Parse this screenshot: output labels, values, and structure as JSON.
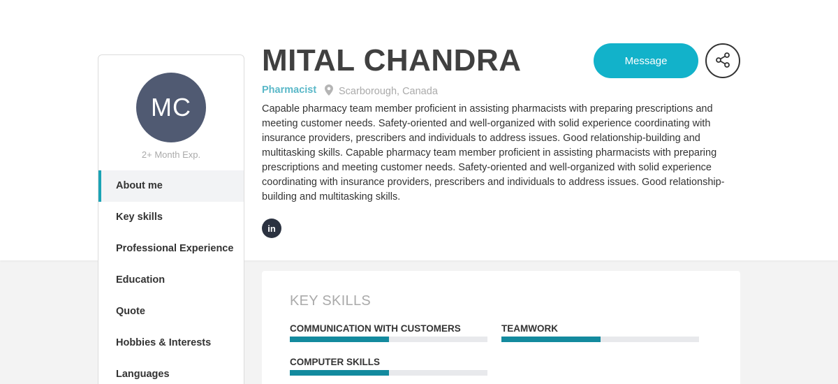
{
  "profile": {
    "initials": "MC",
    "experience": "2+ Month Exp.",
    "name": "MITAL CHANDRA",
    "role": "Pharmacist",
    "location": "Scarborough, Canada",
    "bio": "Capable pharmacy team member proficient in assisting pharmacists with preparing prescriptions and meeting customer needs. Safety-oriented and well-organized with solid experience coordinating with insurance providers, prescribers and individuals to address issues. Good relationship-building and multitasking skills. Capable pharmacy team member proficient in assisting pharmacists with preparing prescriptions and meeting customer needs. Safety-oriented and well-organized with solid experience coordinating with insurance providers, prescribers and individuals to address issues. Good relationship-building and multitasking skills.",
    "social": {
      "linkedin_label": "in"
    }
  },
  "actions": {
    "message_label": "Message",
    "share_icon": "share-icon"
  },
  "sidebar": {
    "items": [
      {
        "label": "About me",
        "active": true
      },
      {
        "label": "Key skills"
      },
      {
        "label": "Professional Experience"
      },
      {
        "label": "Education"
      },
      {
        "label": "Quote"
      },
      {
        "label": "Hobbies & Interests"
      },
      {
        "label": "Languages"
      }
    ]
  },
  "key_skills": {
    "title": "KEY SKILLS",
    "skills": [
      {
        "name": "Communication with customers",
        "level": 0.5
      },
      {
        "name": "Teamwork",
        "level": 0.5
      },
      {
        "name": "Computer skills",
        "level": 0.5
      }
    ]
  },
  "colors": {
    "accent": "#12b2ca",
    "avatar_bg": "#505a72",
    "skill_fill": "#138a9e",
    "role_text": "#5ab8c8"
  }
}
